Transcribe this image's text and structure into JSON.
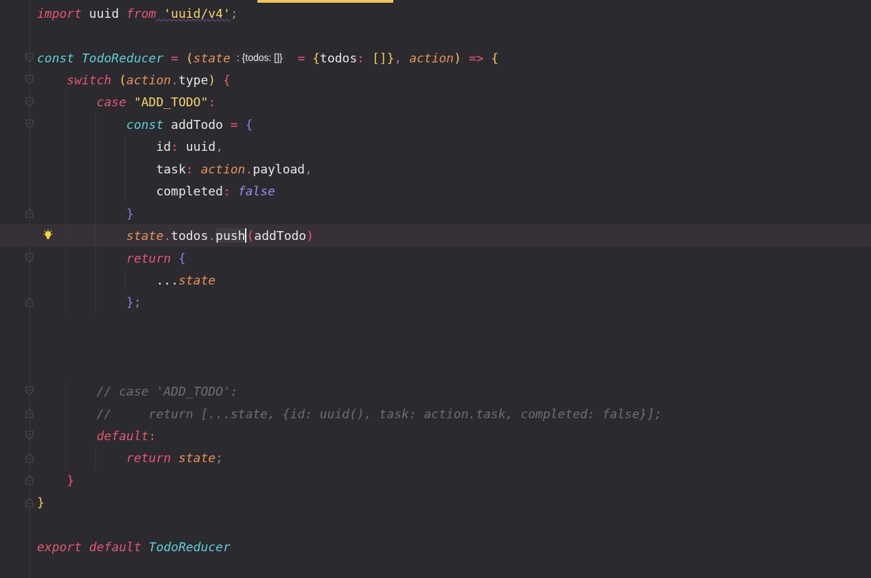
{
  "editor": {
    "lines": [
      {
        "kind": "code",
        "tokens": [
          {
            "text": "import",
            "kind": "keyword"
          },
          {
            "text": " uuid ",
            "kind": "plain"
          },
          {
            "text": "from",
            "kind": "keyword"
          },
          {
            "text": " 'uuid/v4'",
            "kind": "string",
            "warning": true
          },
          {
            "text": ";",
            "kind": "punct"
          }
        ]
      },
      {
        "kind": "blank"
      },
      {
        "kind": "code",
        "fold_start": true,
        "tokens": [
          {
            "text": "const",
            "kind": "declare"
          },
          {
            "text": " TodoReducer",
            "kind": "function"
          },
          {
            "text": " = ",
            "kind": "operator"
          },
          {
            "text": "(",
            "kind": "bracket1"
          },
          {
            "text": "state",
            "kind": "param"
          },
          {
            "text": ": {todos: []}",
            "kind": "hint"
          },
          {
            "text": " = ",
            "kind": "operator"
          },
          {
            "text": "{",
            "kind": "bracket1"
          },
          {
            "text": "todos",
            "kind": "plain"
          },
          {
            "text": ": ",
            "kind": "operator"
          },
          {
            "text": "[]",
            "kind": "bracket1"
          },
          {
            "text": "}",
            "kind": "bracket1"
          },
          {
            "text": ", ",
            "kind": "punct"
          },
          {
            "text": "action",
            "kind": "param"
          },
          {
            "text": ")",
            "kind": "bracket1"
          },
          {
            "text": " => ",
            "kind": "operator"
          },
          {
            "text": "{",
            "kind": "bracket1"
          }
        ]
      },
      {
        "kind": "code",
        "fold_start": true,
        "tokens": [
          {
            "text": "    switch",
            "kind": "keyword"
          },
          {
            "text": " (",
            "kind": "bracket1"
          },
          {
            "text": "action",
            "kind": "param"
          },
          {
            "text": ".",
            "kind": "punct"
          },
          {
            "text": "type",
            "kind": "plain"
          },
          {
            "text": ")",
            "kind": "bracket1"
          },
          {
            "text": " {",
            "kind": "bracket2"
          }
        ]
      },
      {
        "kind": "code",
        "fold_start": true,
        "tokens": [
          {
            "text": "        case",
            "kind": "keyword"
          },
          {
            "text": " \"ADD_TODO\"",
            "kind": "string"
          },
          {
            "text": ":",
            "kind": "operator"
          }
        ]
      },
      {
        "kind": "code",
        "fold_start": true,
        "tokens": [
          {
            "text": "            const",
            "kind": "declare"
          },
          {
            "text": " addTodo ",
            "kind": "plain"
          },
          {
            "text": "=",
            "kind": "operator"
          },
          {
            "text": " {",
            "kind": "bracket3"
          }
        ]
      },
      {
        "kind": "code",
        "tokens": [
          {
            "text": "                id",
            "kind": "plain"
          },
          {
            "text": ": ",
            "kind": "operator"
          },
          {
            "text": "uuid",
            "kind": "plain"
          },
          {
            "text": ",",
            "kind": "punct"
          }
        ]
      },
      {
        "kind": "code",
        "tokens": [
          {
            "text": "                task",
            "kind": "plain"
          },
          {
            "text": ": ",
            "kind": "operator"
          },
          {
            "text": "action",
            "kind": "param"
          },
          {
            "text": ".",
            "kind": "punct"
          },
          {
            "text": "payload",
            "kind": "plain"
          },
          {
            "text": ",",
            "kind": "punct"
          }
        ]
      },
      {
        "kind": "code",
        "tokens": [
          {
            "text": "                completed",
            "kind": "plain"
          },
          {
            "text": ": ",
            "kind": "operator"
          },
          {
            "text": "false",
            "kind": "boolean"
          }
        ]
      },
      {
        "kind": "code",
        "fold_end": true,
        "tokens": [
          {
            "text": "            }",
            "kind": "bracket3"
          }
        ]
      },
      {
        "kind": "code",
        "current": true,
        "bulb": true,
        "tokens": [
          {
            "text": "            state",
            "kind": "param"
          },
          {
            "text": ".",
            "kind": "punct"
          },
          {
            "text": "todos",
            "kind": "plain"
          },
          {
            "text": ".",
            "kind": "punct"
          },
          {
            "text": "push",
            "kind": "plain",
            "caret": true
          },
          {
            "text": "(",
            "kind": "bracket2"
          },
          {
            "text": "addTodo",
            "kind": "plain"
          },
          {
            "text": ")",
            "kind": "bracket2"
          }
        ]
      },
      {
        "kind": "code",
        "fold_start": true,
        "tokens": [
          {
            "text": "            return",
            "kind": "keyword"
          },
          {
            "text": " {",
            "kind": "bracket3"
          }
        ]
      },
      {
        "kind": "code",
        "tokens": [
          {
            "text": "                ...",
            "kind": "plain"
          },
          {
            "text": "state",
            "kind": "param"
          }
        ]
      },
      {
        "kind": "code",
        "fold_end": true,
        "tokens": [
          {
            "text": "            }",
            "kind": "bracket3"
          },
          {
            "text": ";",
            "kind": "punct"
          }
        ]
      },
      {
        "kind": "blank"
      },
      {
        "kind": "blank"
      },
      {
        "kind": "blank"
      },
      {
        "kind": "code",
        "fold_start": true,
        "tokens": [
          {
            "text": "        // case 'ADD_TODO':",
            "kind": "comment"
          }
        ]
      },
      {
        "kind": "code",
        "fold_end": true,
        "tokens": [
          {
            "text": "        //     return [...state, {id: uuid(), task: action.task, completed: false}];",
            "kind": "comment"
          }
        ]
      },
      {
        "kind": "code",
        "fold_start": true,
        "tokens": [
          {
            "text": "        default",
            "kind": "keyword"
          },
          {
            "text": ":",
            "kind": "operator"
          }
        ]
      },
      {
        "kind": "code",
        "fold_end": true,
        "tokens": [
          {
            "text": "            return",
            "kind": "keyword"
          },
          {
            "text": " state",
            "kind": "param"
          },
          {
            "text": ";",
            "kind": "punct"
          }
        ]
      },
      {
        "kind": "code",
        "fold_end": true,
        "tokens": [
          {
            "text": "    }",
            "kind": "bracket2"
          }
        ]
      },
      {
        "kind": "code",
        "fold_end": true,
        "tokens": [
          {
            "text": "}",
            "kind": "bracket1"
          }
        ]
      },
      {
        "kind": "blank"
      },
      {
        "kind": "code",
        "tokens": [
          {
            "text": "export",
            "kind": "keyword"
          },
          {
            "text": " default",
            "kind": "keyword"
          },
          {
            "text": " TodoReducer",
            "kind": "function"
          }
        ]
      }
    ]
  }
}
